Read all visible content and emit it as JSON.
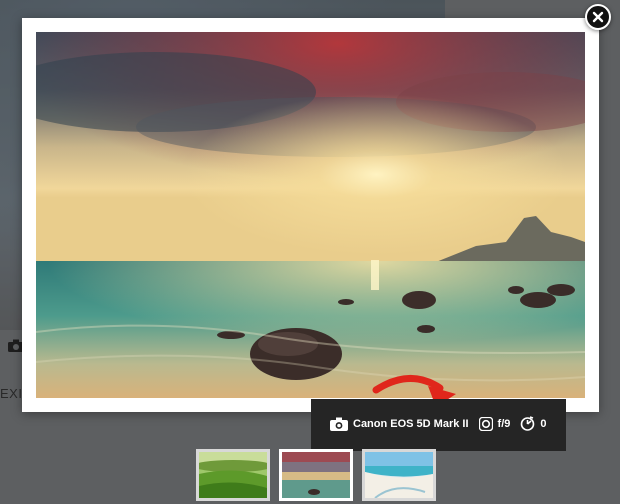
{
  "background_page": {
    "exif_label": "EXIF"
  },
  "lightbox": {
    "close_icon": "close-icon",
    "photo_icon": "beach-sunset-photo"
  },
  "exif": {
    "camera_icon": "camera-icon",
    "camera_model": "Canon EOS 5D Mark II",
    "aperture_icon": "aperture-icon",
    "aperture": "f/9",
    "exposure_icon": "exposure-timer-icon",
    "exposure": "0",
    "arrow_color": "#e0261b"
  },
  "thumbnails": [
    {
      "name": "green-field",
      "active": false
    },
    {
      "name": "beach-sunset",
      "active": true
    },
    {
      "name": "tropical-beach",
      "active": false
    }
  ]
}
